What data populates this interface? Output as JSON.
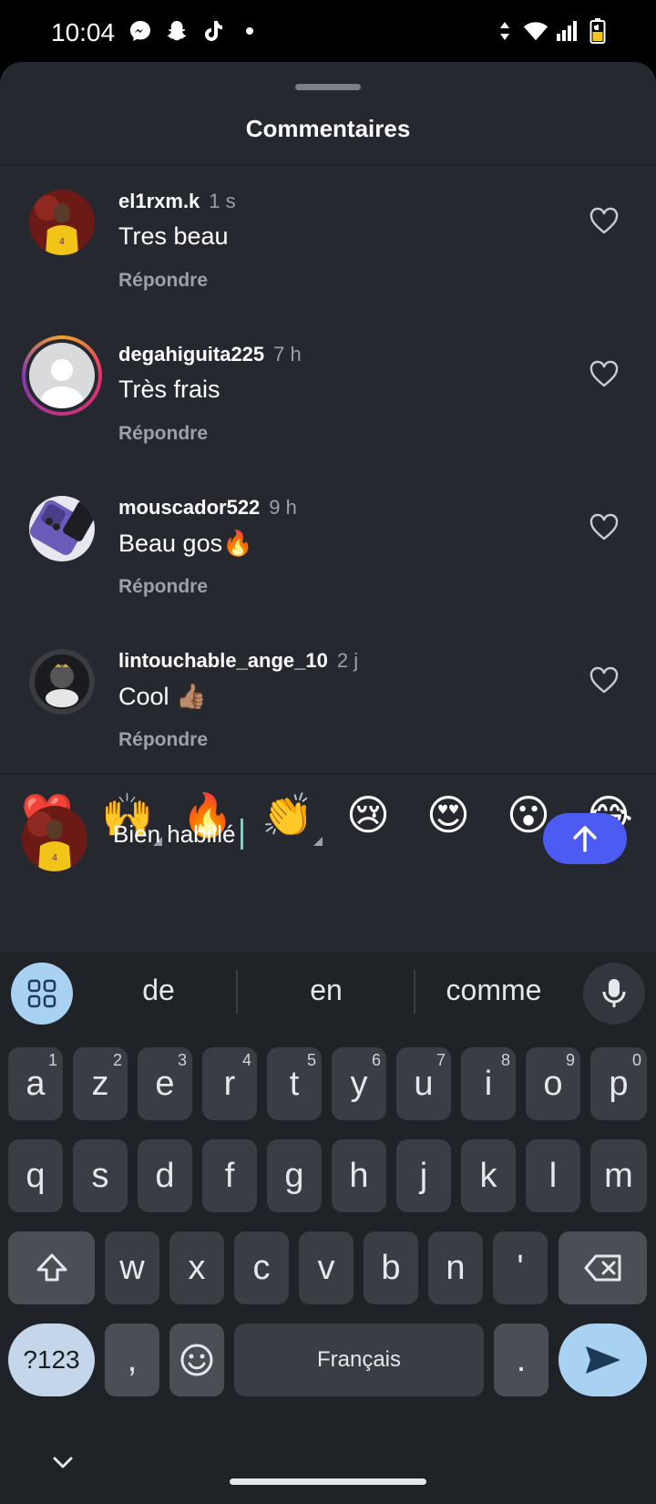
{
  "status_bar": {
    "time": "10:04",
    "left_icons": [
      "messenger-icon",
      "snapchat-icon",
      "tiktok-icon",
      "dot-icon"
    ],
    "right_icons": [
      "data-arrows-icon",
      "wifi-icon",
      "signal-icon",
      "battery-charging-icon"
    ]
  },
  "sheet": {
    "title": "Commentaires"
  },
  "comments": [
    {
      "user": "el1rxm.k",
      "time": "1 s",
      "text": "Tres beau",
      "reply": "Répondre",
      "avatar": "basketball-player-avatar"
    },
    {
      "user": "degahiguita225",
      "time": "7 h",
      "text": "Très frais",
      "reply": "Répondre",
      "avatar": "default-avatar-with-story-ring"
    },
    {
      "user": "mouscador522",
      "time": "9 h",
      "text": "Beau gos🔥",
      "reply": "Répondre",
      "avatar": "purple-phone-avatar"
    },
    {
      "user": "lintouchable_ange_10",
      "time": "2 j",
      "text": "Cool 👍🏽",
      "reply": "Répondre",
      "avatar": "masked-figure-avatar"
    }
  ],
  "emoji_bar": [
    "❤️",
    "🙌",
    "🔥",
    "👏",
    "😢",
    "😍",
    "😮",
    "😂"
  ],
  "composer": {
    "value": "Bien habillé",
    "send_icon": "arrow-up-icon"
  },
  "keyboard": {
    "suggestions": [
      "de",
      "en",
      "comme"
    ],
    "row1": [
      {
        "k": "a",
        "h": "1"
      },
      {
        "k": "z",
        "h": "2"
      },
      {
        "k": "e",
        "h": "3"
      },
      {
        "k": "r",
        "h": "4"
      },
      {
        "k": "t",
        "h": "5"
      },
      {
        "k": "y",
        "h": "6"
      },
      {
        "k": "u",
        "h": "7"
      },
      {
        "k": "i",
        "h": "8"
      },
      {
        "k": "o",
        "h": "9"
      },
      {
        "k": "p",
        "h": "0"
      }
    ],
    "row2": [
      "q",
      "s",
      "d",
      "f",
      "g",
      "h",
      "j",
      "k",
      "l",
      "m"
    ],
    "row3": [
      "w",
      "x",
      "c",
      "v",
      "b",
      "n",
      "'"
    ],
    "sym_label": "?123",
    "comma": ",",
    "space_label": "Français",
    "period": "."
  }
}
